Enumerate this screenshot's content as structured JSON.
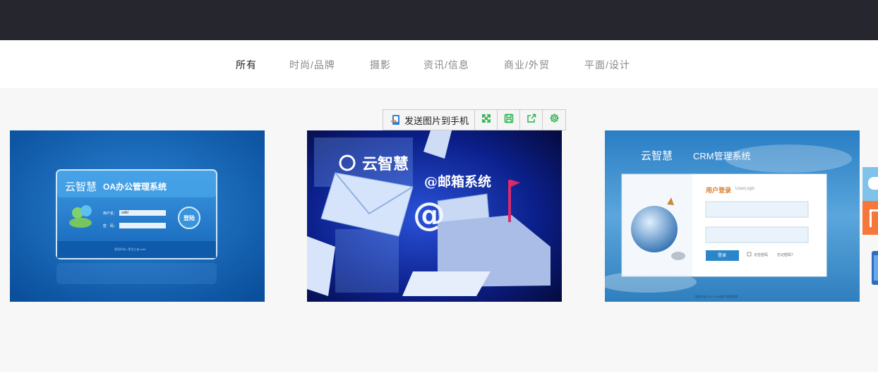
{
  "nav": {
    "items": [
      {
        "label": "所有",
        "active": true
      },
      {
        "label": "时尚/品牌",
        "active": false
      },
      {
        "label": "摄影",
        "active": false
      },
      {
        "label": "资讯/信息",
        "active": false
      },
      {
        "label": "商业/外贸",
        "active": false
      },
      {
        "label": "平面/设计",
        "active": false
      }
    ]
  },
  "toolbar": {
    "send_label": "发送图片到手机",
    "icons": [
      "expand-icon",
      "save-icon",
      "share-icon",
      "settings-icon"
    ],
    "accent": "#2bb24c"
  },
  "thumbs": [
    {
      "brand": "云智慧",
      "system": "OA办公管理系统",
      "user_label": "用户名：",
      "user_value": "wdkl",
      "pass_label": "密　码：",
      "button": "登陆",
      "footer": "版权所有 | 黑龙江省  wdkl"
    },
    {
      "brand": "云智慧",
      "system": "@邮箱系统"
    },
    {
      "brand": "云智慧",
      "system": "CRM管理系统",
      "login_title": "用户登录",
      "login_sub": "UserLogin",
      "button": "登录",
      "remember": "记住密码",
      "forgot": "忘记密码？",
      "footer": "版权所有 2014 CRM客户管理系统"
    }
  ],
  "colors": {
    "topbar": "#26262e",
    "content_bg": "#f7f7f7",
    "side_blue": "#7fc3ea",
    "side_orange": "#f5773a"
  }
}
